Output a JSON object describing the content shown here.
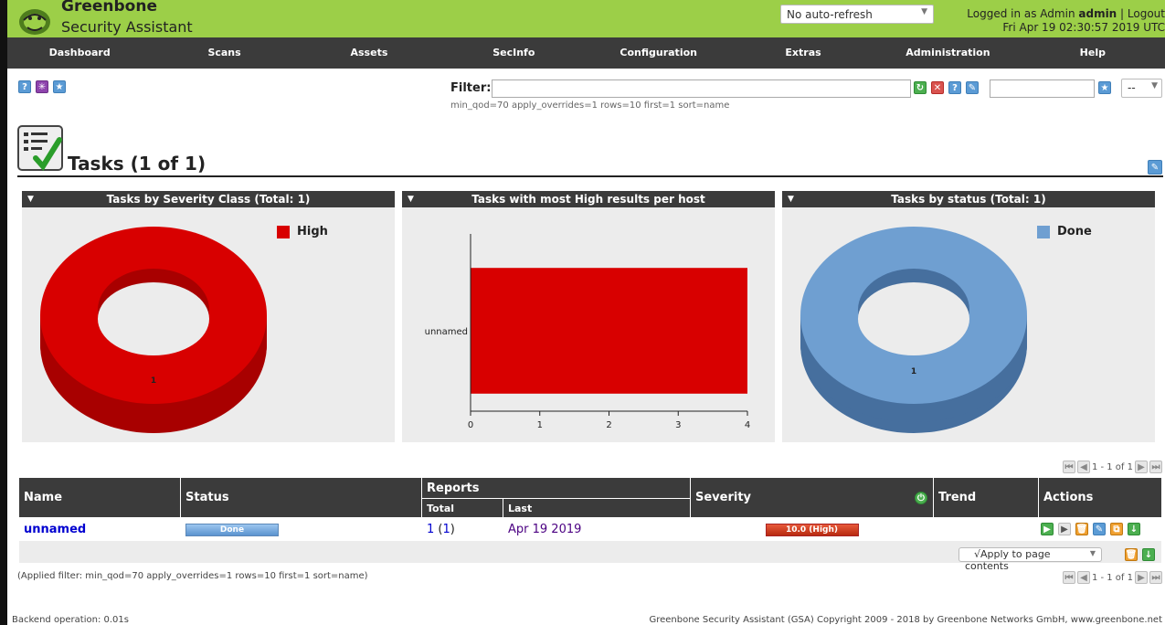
{
  "header": {
    "brand_name": "Greenbone",
    "brand_sub": "Security Assistant",
    "refresh_select": "No auto-refresh",
    "logged_in_prefix": "Logged in as  Admin ",
    "username": "admin",
    "logout": "Logout",
    "datetime": "Fri Apr 19 02:30:57 2019 UTC"
  },
  "nav": [
    "Dashboard",
    "Scans",
    "Assets",
    "SecInfo",
    "Configuration",
    "Extras",
    "Administration",
    "Help"
  ],
  "filter": {
    "label": "Filter",
    "value": "",
    "applied": "min_qod=70 apply_overrides=1 rows=10 first=1 sort=name",
    "select_value": "--"
  },
  "page_title": "Tasks (1 of 1)",
  "panels": [
    {
      "title": "Tasks by Severity Class (Total: 1)",
      "legend": "High",
      "slice_label": "1",
      "color": "#d80000"
    },
    {
      "title": "Tasks with most High results per host"
    },
    {
      "title": "Tasks by status (Total: 1)",
      "legend": "Done",
      "slice_label": "1",
      "color": "#6f9fd1"
    }
  ],
  "chart_data": {
    "type": "bar",
    "orientation": "horizontal",
    "categories": [
      "unnamed"
    ],
    "values": [
      4
    ],
    "xlim": [
      0,
      4
    ],
    "ticks": [
      "0",
      "1",
      "2",
      "3",
      "4"
    ]
  },
  "pager_top": "1 - 1 of 1",
  "pager_bottom": "1 - 1 of 1",
  "table": {
    "headers": {
      "name": "Name",
      "status": "Status",
      "reports": "Reports",
      "total": "Total",
      "last": "Last",
      "severity": "Severity",
      "trend": "Trend",
      "actions": "Actions"
    },
    "row": {
      "name": "unnamed",
      "status": "Done",
      "total": "1",
      "total_paren": "1",
      "last": "Apr 19 2019",
      "severity": "10.0 (High)",
      "severity_value": 10.0
    }
  },
  "bulk_action": "√Apply to page contents",
  "applied_filter_note": "(Applied filter: min_qod=70 apply_overrides=1 rows=10 first=1 sort=name)",
  "footer": {
    "backend": "Backend operation: 0.01s",
    "copyright": "Greenbone Security Assistant (GSA) Copyright 2009 - 2018 by Greenbone Networks GmbH, www.greenbone.net"
  }
}
